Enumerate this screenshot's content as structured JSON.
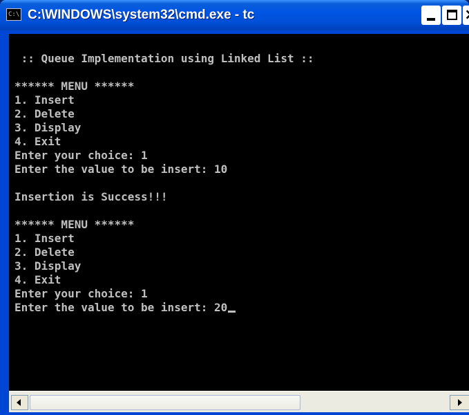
{
  "window": {
    "title": "C:\\WINDOWS\\system32\\cmd.exe - tc",
    "icon": "console-app-icon",
    "icon_text": "C:\\",
    "controls": {
      "minimize": "minimize-icon",
      "maximize": "maximize-icon",
      "close": "close-icon"
    }
  },
  "console": {
    "lines": [
      " :: Queue Implementation using Linked List ::",
      "",
      "****** MENU ******",
      "1. Insert",
      "2. Delete",
      "3. Display",
      "4. Exit",
      "Enter your choice: 1",
      "Enter the value to be insert: 10",
      "",
      "Insertion is Success!!!",
      "",
      "****** MENU ******",
      "1. Insert",
      "2. Delete",
      "3. Display",
      "4. Exit",
      "Enter your choice: 1",
      "Enter the value to be insert: 20"
    ],
    "colors": {
      "background": "#000000",
      "text": "#c0c0c0"
    }
  },
  "scrollbar": {
    "left_arrow": "arrow-left-icon",
    "right_arrow": "arrow-right-icon"
  },
  "theme": {
    "titlebar": "#0054e3",
    "frame": "#0046d5"
  }
}
